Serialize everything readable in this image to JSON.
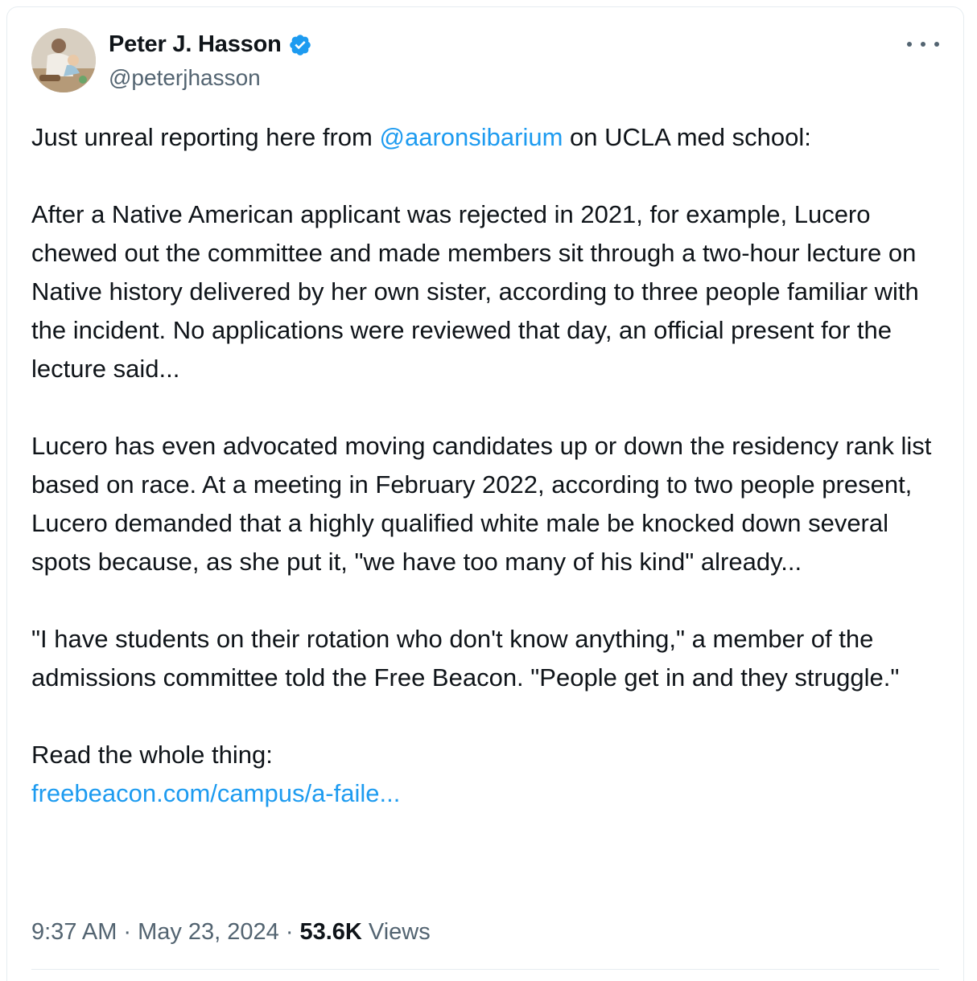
{
  "author": {
    "display_name": "Peter J. Hasson",
    "handle": "@peterjhasson",
    "verified_icon": "verified-badge-icon",
    "avatar_icon": "avatar"
  },
  "tweet": {
    "p1_prefix": "Just unreal reporting here from ",
    "p1_mention": "@aaronsibarium",
    "p1_suffix": " on UCLA med school:",
    "p2": "After a Native American applicant was rejected in 2021, for example, Lucero chewed out the committee and made members sit through a two-hour lecture on Native history delivered by her own sister, according to three people familiar with the incident. No applications were reviewed that day, an official present for the lecture said...",
    "p3": "Lucero has even advocated moving candidates up or down the residency rank list based on race. At a meeting in February 2022, according to two people present, Lucero demanded that a highly qualified white male be knocked down several spots because, as she put it, \"we have too many of his kind\" already...",
    "p4": "\"I have students on their rotation who don't know anything,\" a member of the admissions committee told the Free Beacon. \"People get in and they struggle.\"",
    "p5": "Read the whole thing:",
    "link": "freebeacon.com/campus/a-faile..."
  },
  "meta": {
    "time": "9:37 AM",
    "sep1": "·",
    "date": "May 23, 2024",
    "sep2": "·",
    "views_count": "53.6K",
    "views_label": "Views"
  },
  "colors": {
    "link": "#1d9bf0",
    "secondary_text": "#536471",
    "primary_text": "#0f1419"
  }
}
